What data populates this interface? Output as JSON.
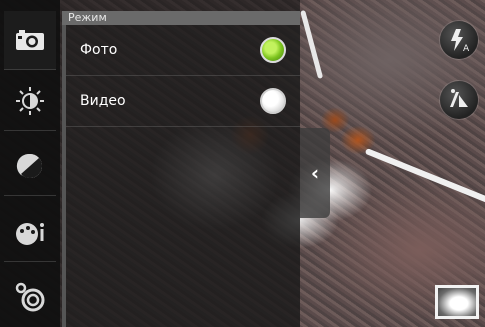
{
  "panel": {
    "header": "Режим",
    "options": [
      {
        "label": "Фото",
        "selected": true
      },
      {
        "label": "Видео",
        "selected": false
      }
    ]
  },
  "toolbar": {
    "items": [
      {
        "icon": "camera-icon",
        "active": true
      },
      {
        "icon": "brightness-icon",
        "active": false
      },
      {
        "icon": "exposure-icon",
        "active": false
      },
      {
        "icon": "scene-info-icon",
        "active": false
      },
      {
        "icon": "settings-icon",
        "active": false
      }
    ]
  },
  "controls": {
    "flash": {
      "icon": "flash-auto-icon",
      "badge": "A"
    },
    "switch_camera": {
      "icon": "switch-camera-icon"
    },
    "collapse": {
      "icon": "chevron-left-icon",
      "glyph": "‹"
    },
    "thumbnail": {
      "icon": "gallery-thumbnail"
    }
  },
  "colors": {
    "accent_green": "#7ec51f",
    "panel_header": "#6a6a6a"
  }
}
